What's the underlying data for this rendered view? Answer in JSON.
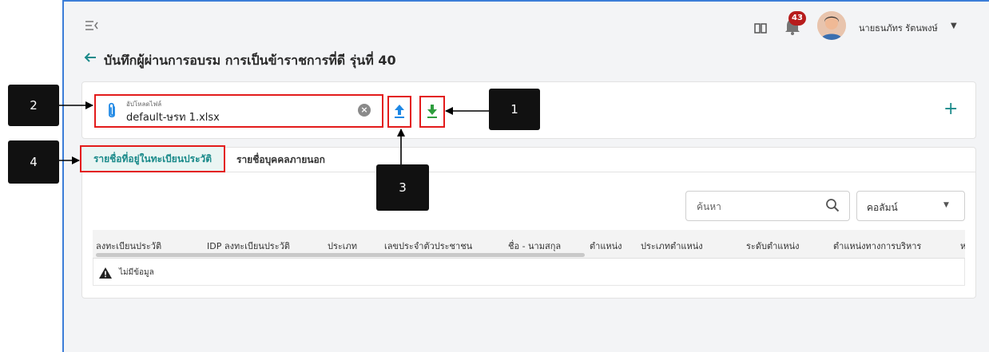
{
  "header": {
    "notification_count": "43",
    "user_name": "นายธนภัทร รัตนพงษ์"
  },
  "page": {
    "title": "บันทึกผู้ผ่านการอบรม การเป็นข้าราชการที่ดี รุ่นที่ 40"
  },
  "upload": {
    "field_label": "อัปโหลดไฟล์",
    "file_name": "default-ษรท 1.xlsx",
    "clear_symbol": "×",
    "add_symbol": "+"
  },
  "tabs": [
    {
      "label": "รายชื่อที่อยู่ในทะเบียนประวัติ",
      "active": true
    },
    {
      "label": "รายชื่อบุคคลภายนอก",
      "active": false
    }
  ],
  "table": {
    "search_placeholder": "ค้นหา",
    "column_select_label": "คอลัมน์",
    "columns": [
      "ลงทะเบียนประวัติ",
      "IDP ลงทะเบียนประวัติ",
      "ประเภท",
      "เลขประจำตัวประชาชน",
      "ชื่อ - นามสกุล",
      "ตำแหน่ง",
      "ประเภทตำแหน่ง",
      "ระดับตำแหน่ง",
      "ตำแหน่งทางการบริหาร",
      "ห"
    ],
    "empty_text": "ไม่มีข้อมูล"
  },
  "callouts": {
    "c1": "1",
    "c2": "2",
    "c3": "3",
    "c4": "4"
  },
  "icons": {
    "menu": "menu-collapse-icon",
    "back": "arrow-left-icon",
    "book": "book-icon",
    "bell": "bell-icon",
    "clip": "paperclip-icon",
    "upload": "upload-icon",
    "download": "download-icon",
    "search": "search-icon",
    "warning": "warning-icon"
  },
  "colors": {
    "accent": "#1a8a8a",
    "highlight_border": "#e31b1b",
    "badge": "#b71c1c",
    "upload_icon": "#1e88e5",
    "download_icon": "#2e9e3e"
  }
}
